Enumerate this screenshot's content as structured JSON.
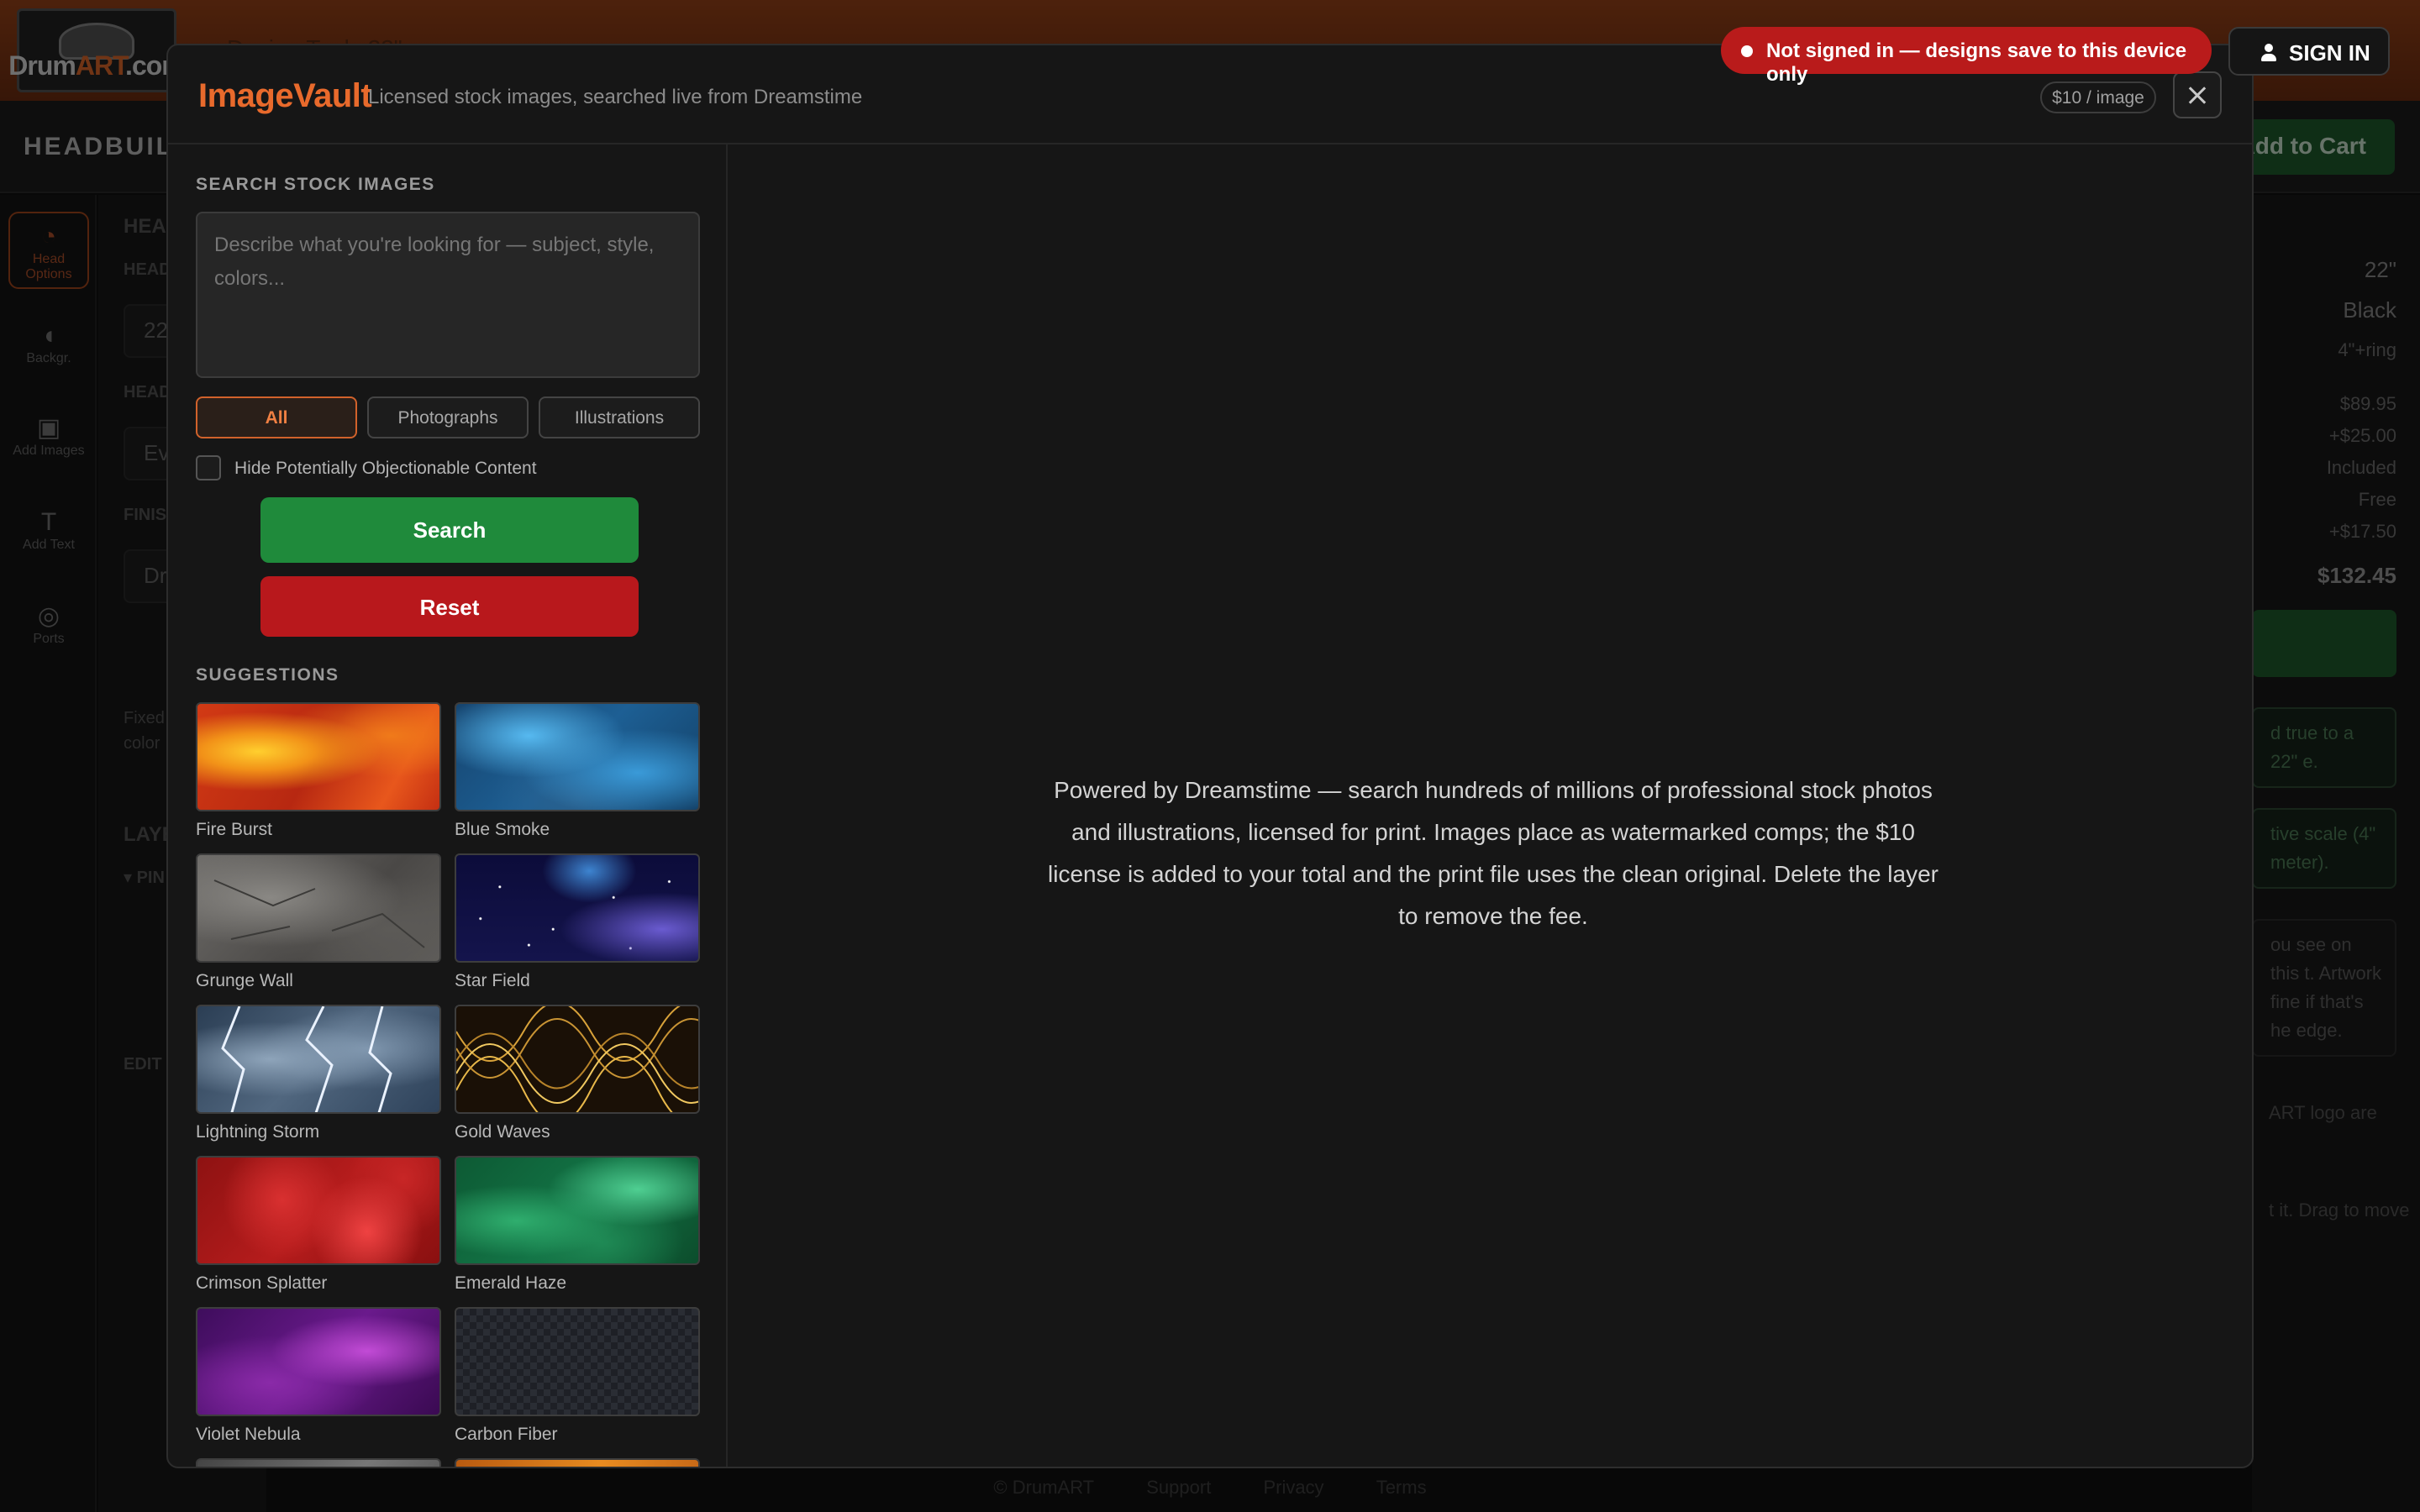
{
  "app": {
    "logo_text_main": "Drum",
    "logo_text_accent": "ART",
    "logo_text_tail": ".com",
    "brand": "HEADBUILDER",
    "add_to_cart": "Add to Cart",
    "top_hint": "Design Tools 22\""
  },
  "rail": {
    "items": [
      {
        "icon": "drum-head-icon",
        "label": "Head Options",
        "active": true
      },
      {
        "icon": "background-icon",
        "label": "Backgr.",
        "active": false
      },
      {
        "icon": "image-icon",
        "label": "Add Images",
        "active": false
      },
      {
        "icon": "text-icon",
        "label": "Add Text",
        "active": false
      },
      {
        "icon": "ports-icon",
        "label": "Ports",
        "active": false
      }
    ]
  },
  "left_panel": {
    "heading": "HEA",
    "label1": "HEAD",
    "value1": "22",
    "label2": "HEAD",
    "value2": "Ev",
    "label3": "FINIS",
    "value3": "Dr",
    "note": "Fixed the he color",
    "layers": "LAYE",
    "pinned": "▾ PIN",
    "edit": "EDIT"
  },
  "right_panel": {
    "size": "22\"",
    "color": "Black",
    "port": "4\"+ring",
    "base_price": "$89.95",
    "addon1": "+$25.00",
    "included": "Included",
    "free": "Free",
    "addon2": "+$17.50",
    "total": "$132.45",
    "note1": "d true to a 22\" e.",
    "note2": "tive scale (4\" meter).",
    "note3": "ou see on this t. Artwork fine if that's he edge.",
    "note4": "ART logo are",
    "note5": "t it. Drag to move"
  },
  "footer": [
    "© DrumART",
    "Support",
    "Privacy",
    "Terms"
  ],
  "toast": {
    "text": "Not signed in — designs save to this device only",
    "color": "#b91b1b"
  },
  "signin": {
    "label": "SIGN IN"
  },
  "modal": {
    "title": "ImageVault",
    "subtitle": "Licensed stock images, searched live from Dreamstime",
    "price_badge": "$10 / image",
    "search_section": "SEARCH STOCK IMAGES",
    "search_placeholder": "Describe what you're looking for — subject, style, colors...",
    "search_value": "",
    "filters": [
      {
        "label": "All",
        "active": true
      },
      {
        "label": "Photographs",
        "active": false
      },
      {
        "label": "Illustrations",
        "active": false
      }
    ],
    "hide_objectionable": {
      "label": "Hide Potentially Objectionable Content",
      "checked": false
    },
    "search_button": "Search",
    "reset_button": "Reset",
    "suggestions_label": "SUGGESTIONS",
    "suggestions": [
      "Fire Burst",
      "Blue Smoke",
      "Grunge Wall",
      "Star Field",
      "Lightning Storm",
      "Gold Waves",
      "Crimson Splatter",
      "Emerald Haze",
      "Violet Nebula",
      "Carbon Fiber"
    ],
    "info": "Powered by Dreamstime — search hundreds of millions of professional stock photos and illustrations, licensed for print. Images place as watermarked comps; the $10 license is added to your total and the print file uses the clean original. Delete the layer to remove the fee.",
    "colors": {
      "accent": "#e86a2c",
      "search_green": "#1f8a3b",
      "reset_red": "#b8181c"
    }
  }
}
